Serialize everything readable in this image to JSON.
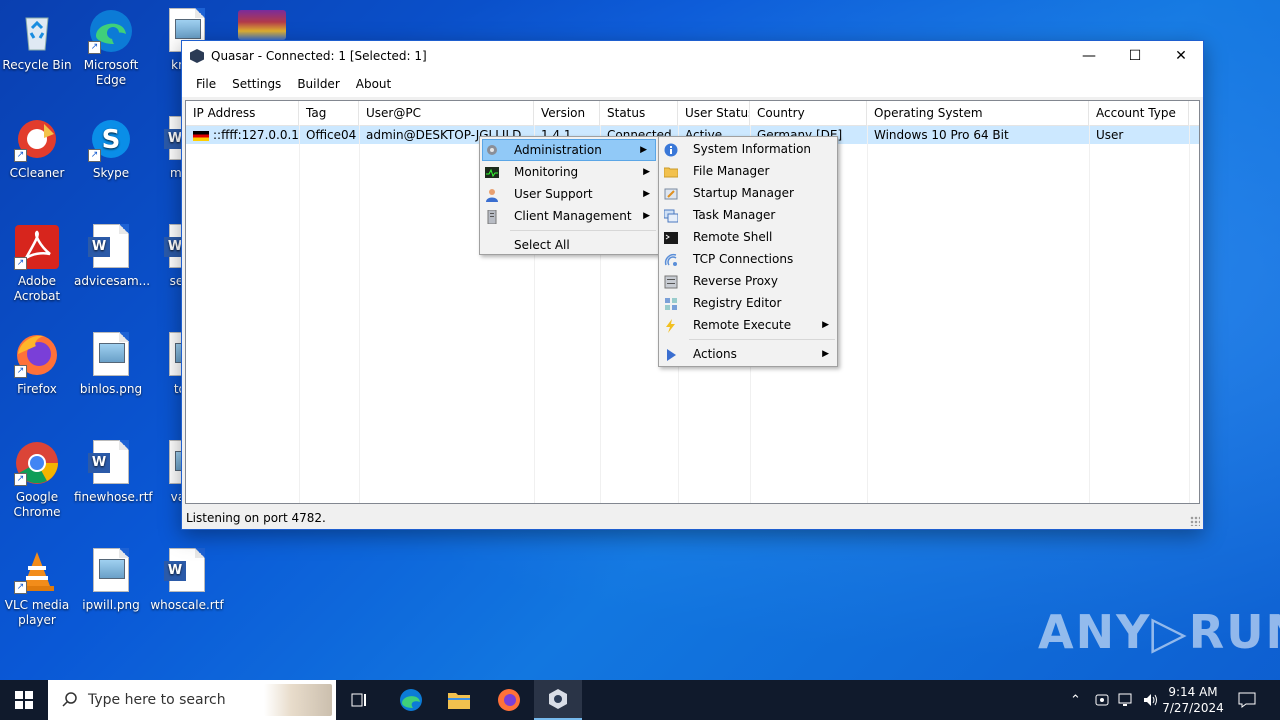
{
  "desktop": {
    "icons": [
      {
        "label": "Recycle Bin"
      },
      {
        "label": "Microsoft Edge"
      },
      {
        "label": "know"
      },
      {
        "label": "CCleaner"
      },
      {
        "label": "Skype"
      },
      {
        "label": "made"
      },
      {
        "label": "Adobe Acrobat"
      },
      {
        "label": "advicesam..."
      },
      {
        "label": "sense"
      },
      {
        "label": "Firefox"
      },
      {
        "label": "binlos.png"
      },
      {
        "label": "took"
      },
      {
        "label": "Google Chrome"
      },
      {
        "label": "finewhose.rtf"
      },
      {
        "label": "value"
      },
      {
        "label": "VLC media player"
      },
      {
        "label": "ipwill.png"
      },
      {
        "label": "whoscale.rtf"
      }
    ],
    "watermark": "ANY▷RUN"
  },
  "window": {
    "title": "Quasar - Connected: 1 [Selected: 1]",
    "controls": {
      "minimize": "—",
      "maximize": "☐",
      "close": "✕"
    },
    "menu": [
      "File",
      "Settings",
      "Builder",
      "About"
    ],
    "columns": [
      "IP Address",
      "Tag",
      "User@PC",
      "Version",
      "Status",
      "User Status",
      "Country",
      "Operating System",
      "Account Type"
    ],
    "row": [
      "::ffff:127.0.0.1",
      "Office04",
      "admin@DESKTOP-JGLLJLD",
      "1.4.1",
      "Connected",
      "Active",
      "Germany [DE]",
      "Windows 10 Pro 64 Bit",
      "User"
    ],
    "status": "Listening on port 4782."
  },
  "context_menu": {
    "items": [
      "Administration",
      "Monitoring",
      "User Support",
      "Client Management"
    ],
    "select_all": "Select All"
  },
  "submenu": {
    "items": [
      "System Information",
      "File Manager",
      "Startup Manager",
      "Task Manager",
      "Remote Shell",
      "TCP Connections",
      "Reverse Proxy",
      "Registry Editor",
      "Remote Execute"
    ],
    "actions": "Actions"
  },
  "taskbar": {
    "search_placeholder": "Type here to search",
    "time": "9:14 AM",
    "date": "7/27/2024"
  }
}
